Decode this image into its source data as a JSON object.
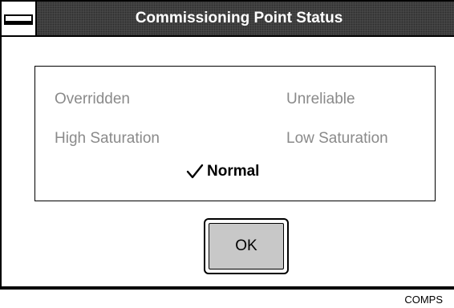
{
  "dialog": {
    "title": "Commissioning Point Status",
    "statuses": [
      {
        "label": "Overridden",
        "enabled": false
      },
      {
        "label": "Unreliable",
        "enabled": false
      },
      {
        "label": "High Saturation",
        "enabled": false
      },
      {
        "label": "Low Saturation",
        "enabled": false
      }
    ],
    "selected_status": "Normal",
    "ok_label": "OK"
  },
  "caption": "COMPS",
  "colors": {
    "title_bar": "#4a4a4a",
    "disabled_text": "#8a8a8a",
    "button_face": "#c8c8c8"
  },
  "icons": {
    "system_menu": "system-menu-icon",
    "check": "check-icon"
  }
}
